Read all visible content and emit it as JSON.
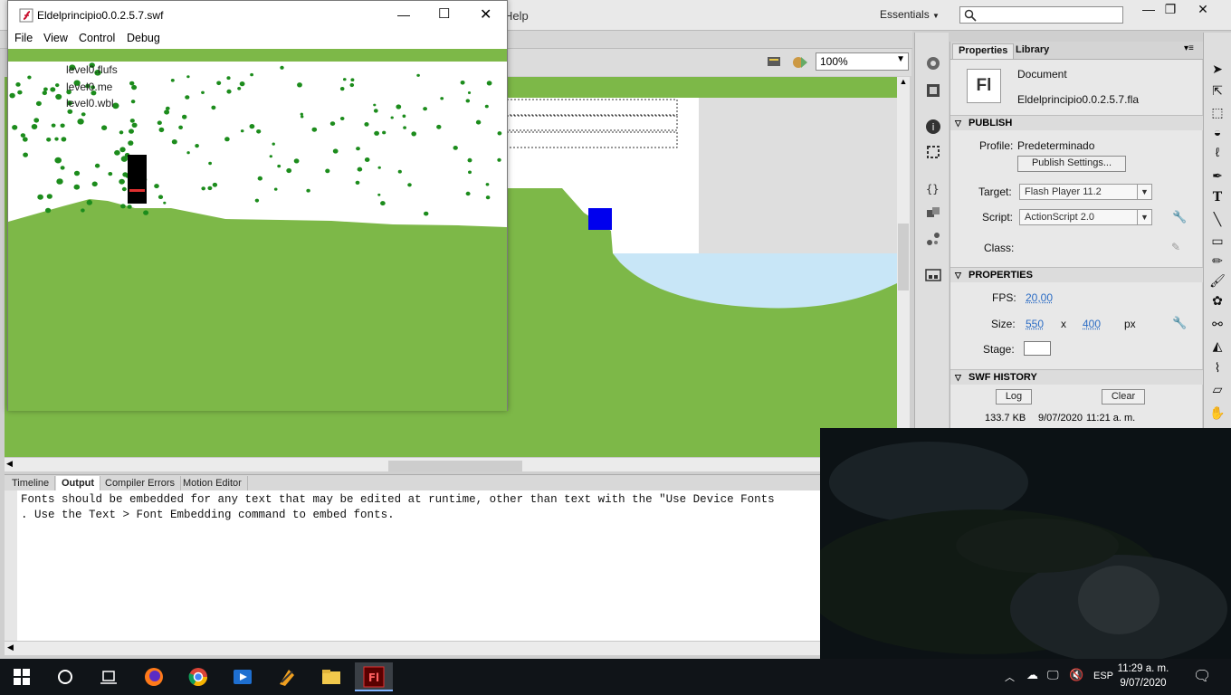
{
  "ide": {
    "menu_help": "Help",
    "workspace": "Essentials",
    "zoom": "100%"
  },
  "properties": {
    "tab_properties": "Properties",
    "tab_library": "Library",
    "doc_icon": "Fl",
    "doc_type": "Document",
    "doc_file": "Eldelprincipio0.0.2.5.7.fla",
    "publish_header": "PUBLISH",
    "profile_label": "Profile:",
    "profile_value": "Predeterminado",
    "publish_settings": "Publish Settings...",
    "target_label": "Target:",
    "target_value": "Flash Player 11.2",
    "script_label": "Script:",
    "script_value": "ActionScript 2.0",
    "class_label": "Class:",
    "properties_header": "PROPERTIES",
    "fps_label": "FPS:",
    "fps_value": "20,00",
    "size_label": "Size:",
    "size_w": "550",
    "size_x": "x",
    "size_h": "400",
    "size_unit": "px",
    "stage_label": "Stage:",
    "stage_color": "#ffffff",
    "swf_history_header": "SWF HISTORY",
    "log_button": "Log",
    "clear_button": "Clear",
    "history_size": "133.7 KB",
    "history_date": "9/07/2020",
    "history_time": "11:21 a. m."
  },
  "output": {
    "tabs": [
      "Timeline",
      "Output",
      "Compiler Errors",
      "Motion Editor"
    ],
    "active_tab": "Output",
    "line1": "Fonts should be embedded for any text that may be edited at runtime, other than text with the \"Use Device Fonts",
    "line2": ". Use the Text > Font Embedding command to embed fonts."
  },
  "swf_window": {
    "title": "Eldelprincipio0.0.2.5.7.swf",
    "menu": [
      "File",
      "View",
      "Control",
      "Debug"
    ],
    "trace_lines": [
      "level0.flufs",
      "level0.me",
      "level0.wbl"
    ]
  },
  "taskbar": {
    "lang": "ESP",
    "time": "11:29 a. m.",
    "date": "9/07/2020"
  },
  "colors": {
    "grass": "#7db848",
    "water": "#c8e6f7",
    "block": "#0000ee",
    "leaf": "#1c8c1c",
    "flash_red": "#c8102e"
  }
}
